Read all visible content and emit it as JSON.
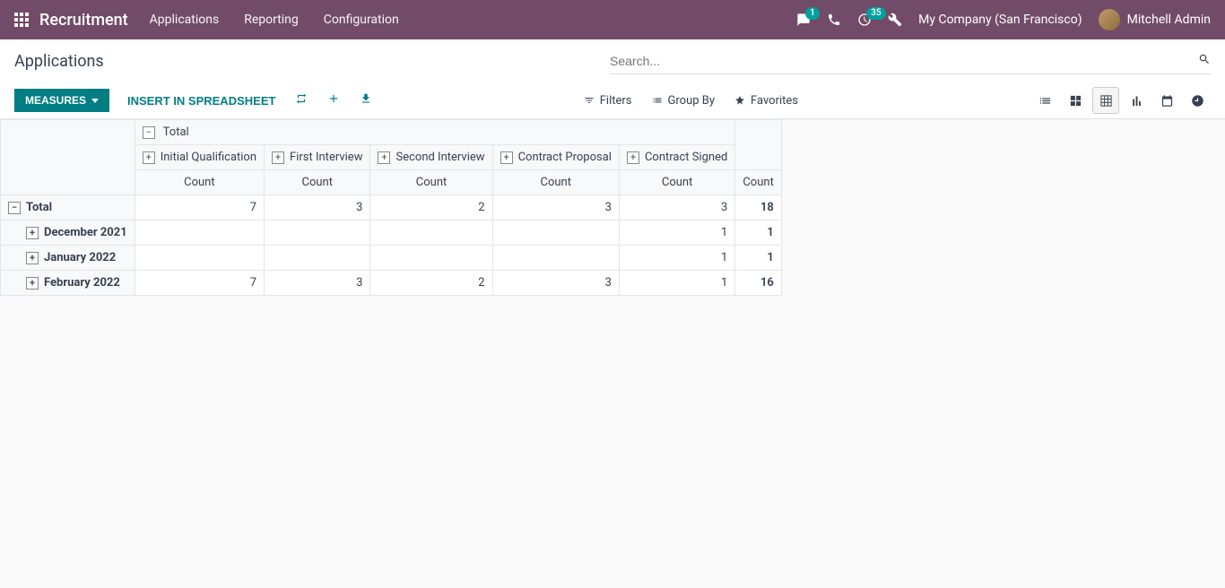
{
  "navbar": {
    "brand": "Recruitment",
    "links": [
      "Applications",
      "Reporting",
      "Configuration"
    ],
    "messages_badge": "1",
    "activities_badge": "35",
    "company": "My Company (San Francisco)",
    "user": "Mitchell Admin"
  },
  "page": {
    "title": "Applications",
    "search_placeholder": "Search..."
  },
  "buttons": {
    "measures": "MEASURES",
    "insert": "INSERT IN SPREADSHEET"
  },
  "search_options": {
    "filters": "Filters",
    "group_by": "Group By",
    "favorites": "Favorites"
  },
  "pivot": {
    "total_label": "Total",
    "count_label": "Count",
    "columns": [
      "Initial Qualification",
      "First Interview",
      "Second Interview",
      "Contract Proposal",
      "Contract Signed"
    ],
    "rows": [
      {
        "label": "Total",
        "level": 0,
        "expanded": true,
        "values": [
          "7",
          "3",
          "2",
          "3",
          "3"
        ],
        "total": "18"
      },
      {
        "label": "December 2021",
        "level": 1,
        "expanded": false,
        "values": [
          "",
          "",
          "",
          "",
          "1"
        ],
        "total": "1"
      },
      {
        "label": "January 2022",
        "level": 1,
        "expanded": false,
        "values": [
          "",
          "",
          "",
          "",
          "1"
        ],
        "total": "1"
      },
      {
        "label": "February 2022",
        "level": 1,
        "expanded": false,
        "values": [
          "7",
          "3",
          "2",
          "3",
          "1"
        ],
        "total": "16"
      }
    ]
  }
}
